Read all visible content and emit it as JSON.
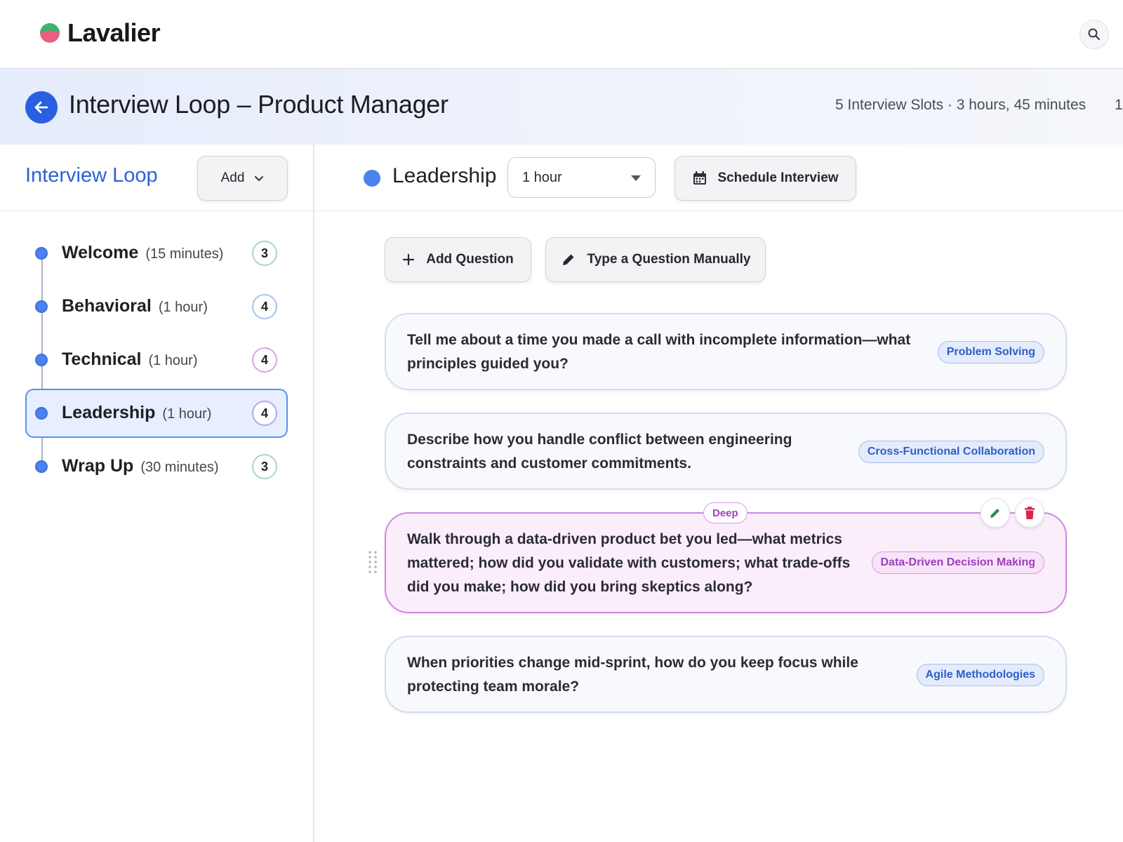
{
  "brand": {
    "name": "Lavalier",
    "logo_colors": [
      "#3bb56b",
      "#e8607f"
    ]
  },
  "header": {
    "title": "Interview Loop – Product Manager",
    "meta": "5 Interview Slots · 3 hours, 45 minutes",
    "meta_overflow": "1"
  },
  "sidebar": {
    "title": "Interview Loop",
    "add_label": "Add",
    "stages": [
      {
        "name": "Welcome",
        "duration": "(15 minutes)",
        "count": "3",
        "ring": "#a8d8b9"
      },
      {
        "name": "Behavioral",
        "duration": "(1 hour)",
        "count": "4",
        "ring": "#a9c1f2"
      },
      {
        "name": "Technical",
        "duration": "(1 hour)",
        "count": "4",
        "ring": "#d7a4e6"
      },
      {
        "name": "Leadership",
        "duration": "(1 hour)",
        "count": "4",
        "ring": "#b5a6ea",
        "active": true
      },
      {
        "name": "Wrap Up",
        "duration": "(30 minutes)",
        "count": "3",
        "ring": "#a8d8b9"
      }
    ]
  },
  "main": {
    "stage_title": "Leadership",
    "duration_value": "1 hour",
    "schedule_label": "Schedule Interview",
    "add_question_label": "Add Question",
    "type_manually_label": "Type a Question Manually",
    "questions": [
      {
        "lines": [
          "Tell me about a time you made a call with incomplete information—what",
          "principles guided you?"
        ],
        "tag": "Problem Solving"
      },
      {
        "lines": [
          "Describe how you handle conflict between engineering",
          "constraints and customer commitments."
        ],
        "tag": "Cross-Functional Collaboration"
      },
      {
        "lines": [
          "Walk through a data-driven product bet you led—what metrics",
          "mattered; how did you validate with customers; what trade-offs",
          "did you make; how did you bring skeptics along?"
        ],
        "tag": "Data-Driven Decision Making",
        "badge": "Deep"
      },
      {
        "lines": [
          "When priorities change mid-sprint, how do you keep focus while",
          "protecting team morale?"
        ],
        "tag": "Agile Methodologies"
      }
    ]
  },
  "icons": {
    "search": "search-icon",
    "back": "arrow-left-icon",
    "chevron": "chevron-down-icon",
    "calendar": "calendar-icon",
    "plus": "plus-icon",
    "pencil": "pencil-icon",
    "edit": "edit-icon",
    "trash": "trash-icon",
    "drag": "drag-handle-icon"
  },
  "colors": {
    "accent": "#2a5fe0",
    "active_bg": "#e6eeff",
    "deep_border": "#cf88e0",
    "edit": "#2d8a4a",
    "delete": "#d6284f"
  }
}
